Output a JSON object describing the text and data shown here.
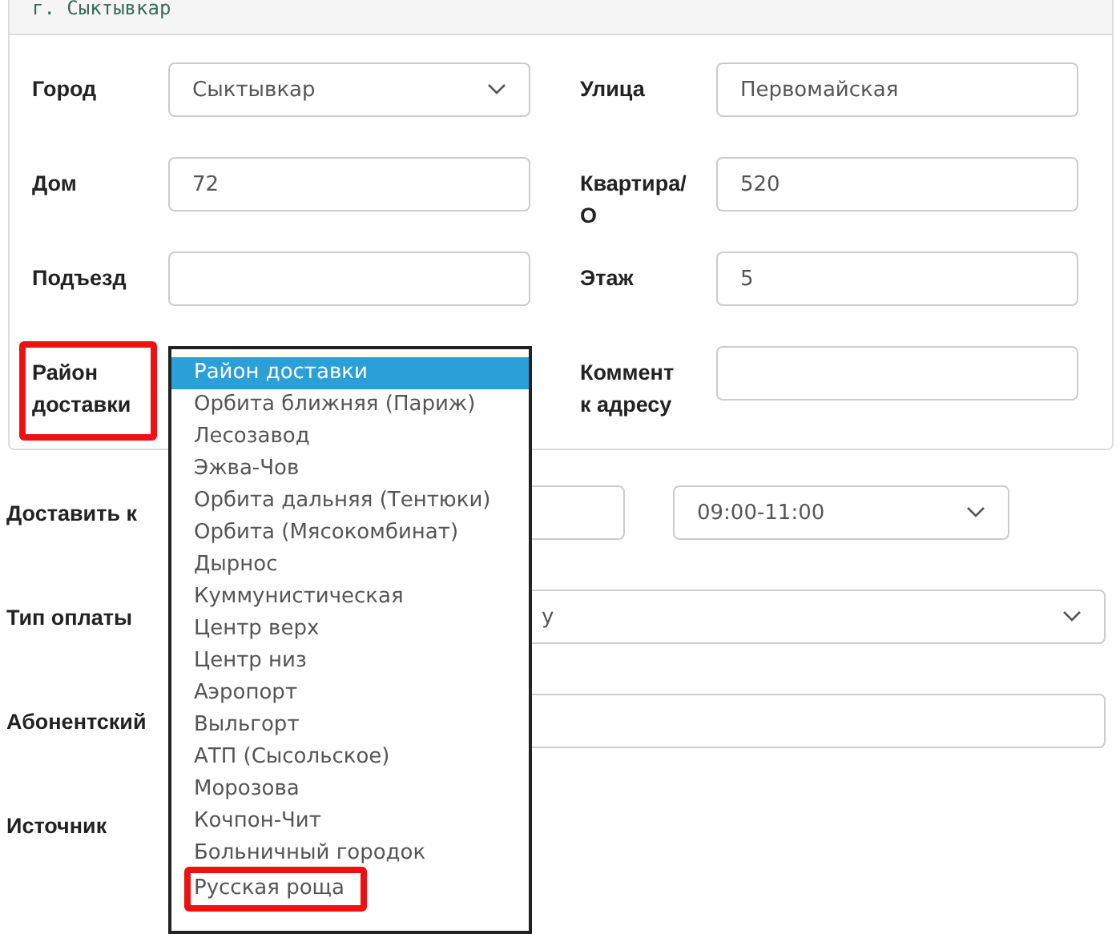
{
  "panel": {
    "title": "г. Сыктывкар",
    "fields": [
      {
        "label": "Город",
        "kind": "select",
        "value": "Сыктывкар",
        "highlighted": false
      },
      {
        "label": "Улица",
        "kind": "input",
        "value": "Первомайская",
        "highlighted": false
      },
      {
        "label": "Дом",
        "kind": "input",
        "value": "72",
        "highlighted": false
      },
      {
        "label": "Квартира/О",
        "kind": "input",
        "value": "520",
        "highlighted": false
      },
      {
        "label": "Подъезд",
        "kind": "input",
        "highlighted": false
      },
      {
        "label": "Этаж",
        "kind": "input",
        "value": "5",
        "highlighted": false
      },
      {
        "label": "Район доставки",
        "kind": "covered",
        "highlighted": true
      },
      {
        "label": "Коммент к адресу",
        "kind": "input",
        "highlighted": false
      }
    ]
  },
  "form": {
    "rows": [
      {
        "label": "Доставить к",
        "kind": "datetime",
        "time": "09:00-11:00"
      },
      {
        "label": "Тип оплаты",
        "kind": "select",
        "value": "у"
      },
      {
        "label": "Абонентский",
        "kind": "input"
      },
      {
        "label": "Источник",
        "kind": "none"
      }
    ]
  },
  "dropdown": {
    "options": [
      {
        "label": "Район доставки",
        "selected": true,
        "highlighted": false
      },
      {
        "label": "Орбита ближняя (Париж)",
        "selected": false,
        "highlighted": false
      },
      {
        "label": "Лесозавод",
        "selected": false,
        "highlighted": false
      },
      {
        "label": "Эжва-Чов",
        "selected": false,
        "highlighted": false
      },
      {
        "label": "Орбита дальняя (Тентюки)",
        "selected": false,
        "highlighted": false
      },
      {
        "label": "Орбита (Мясокомбинат)",
        "selected": false,
        "highlighted": false
      },
      {
        "label": "Дырнос",
        "selected": false,
        "highlighted": false
      },
      {
        "label": "Куммунистическая",
        "selected": false,
        "highlighted": false
      },
      {
        "label": "Центр верх",
        "selected": false,
        "highlighted": false
      },
      {
        "label": "Центр низ",
        "selected": false,
        "highlighted": false
      },
      {
        "label": "Аэропорт",
        "selected": false,
        "highlighted": false
      },
      {
        "label": "Выльгорт",
        "selected": false,
        "highlighted": false
      },
      {
        "label": "АТП (Сысольское)",
        "selected": false,
        "highlighted": false
      },
      {
        "label": "Морозова",
        "selected": false,
        "highlighted": false
      },
      {
        "label": "Кочпон-Чит",
        "selected": false,
        "highlighted": false
      },
      {
        "label": "Больничный городок",
        "selected": false,
        "highlighted": false
      },
      {
        "label": "Русская роща",
        "selected": false,
        "highlighted": true
      }
    ]
  }
}
